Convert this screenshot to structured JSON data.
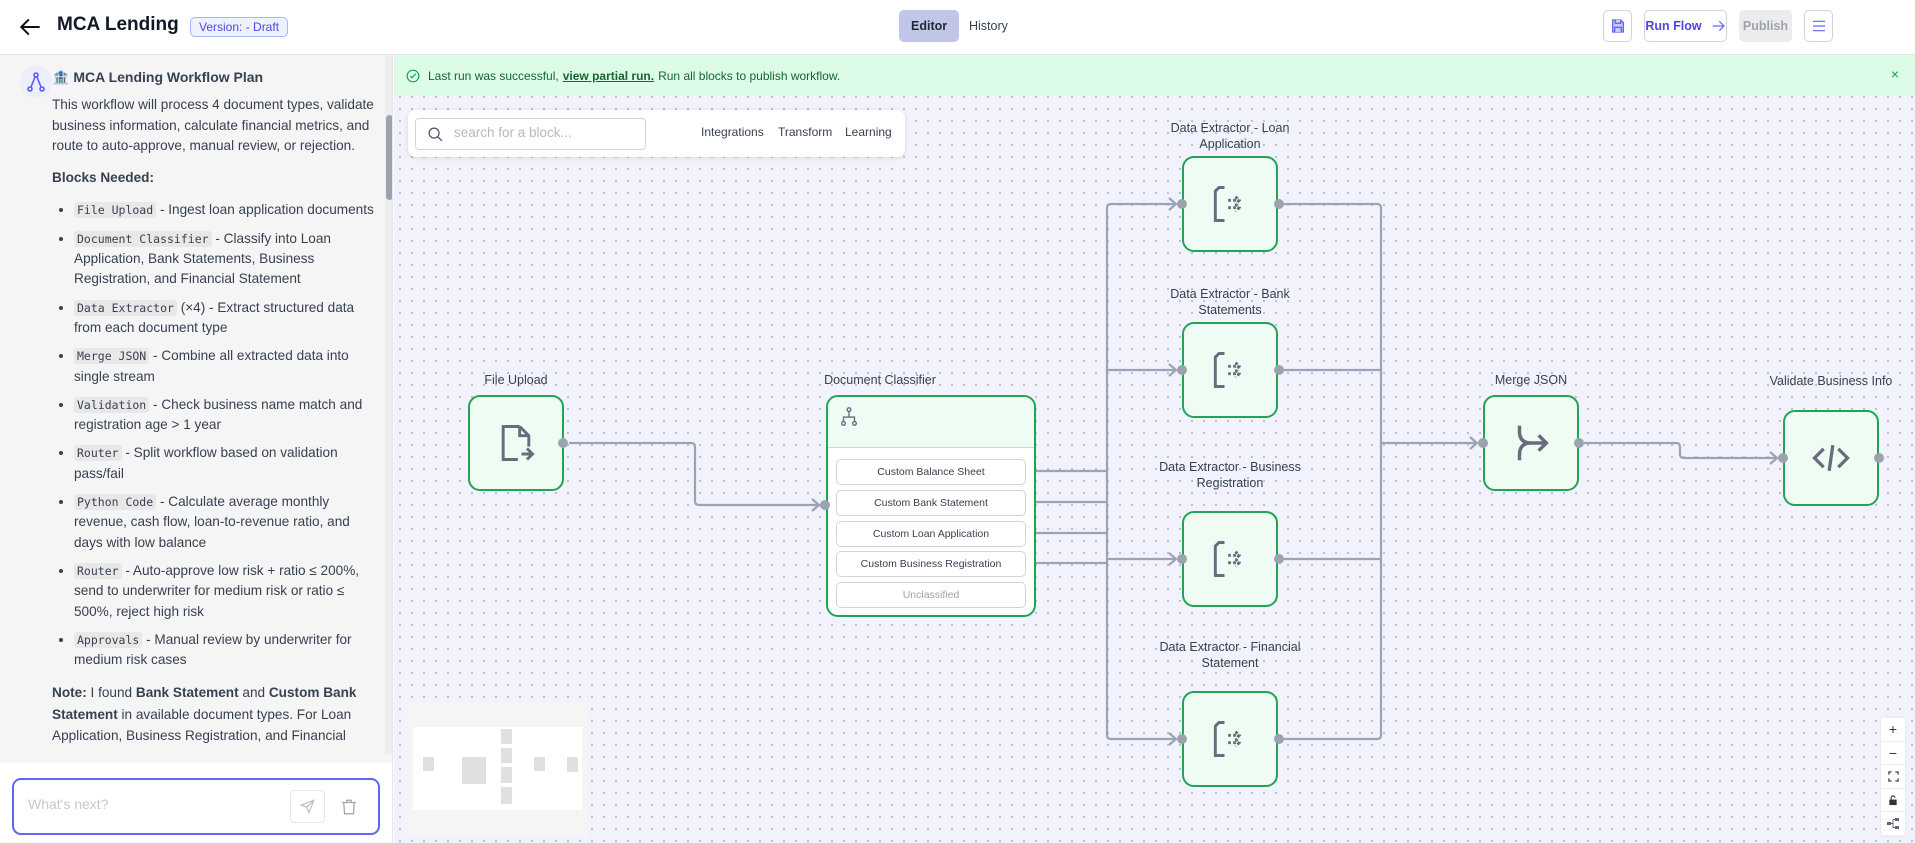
{
  "header": {
    "title": "MCA Lending",
    "version_badge": "Version: - Draft",
    "tabs": [
      {
        "label": "Editor",
        "active": true
      },
      {
        "label": "History",
        "active": false
      }
    ],
    "run_flow_label": "Run Flow",
    "publish_label": "Publish",
    "accent": "#4f46e5"
  },
  "sidebar": {
    "heading": "🏦 MCA Lending Workflow Plan",
    "intro": "This workflow will process 4 document types, validate business information, calculate financial metrics, and route to auto-approve, manual review, or rejection.",
    "blocks_heading": "Blocks Needed:",
    "items": [
      {
        "code": "File Upload",
        "text": " - Ingest loan application documents"
      },
      {
        "code": "Document Classifier",
        "text": " - Classify into Loan Application, Bank Statements, Business Registration, and Financial Statement"
      },
      {
        "code": "Data Extractor",
        "text": " (×4) - Extract structured data from each document type"
      },
      {
        "code": "Merge JSON",
        "text": " - Combine all extracted data into single stream"
      },
      {
        "code": "Validation",
        "text": " - Check business name match and registration age > 1 year"
      },
      {
        "code": "Router",
        "text": " - Split workflow based on validation pass/fail"
      },
      {
        "code": "Python Code",
        "text": " - Calculate average monthly revenue, cash flow, loan-to-revenue ratio, and days with low balance"
      },
      {
        "code": "Router",
        "text": " - Auto-approve low risk + ratio ≤ 200%, send to underwriter for medium risk or ratio ≤ 500%, reject high risk"
      },
      {
        "code": "Approvals",
        "text": " - Manual review by underwriter for medium risk cases"
      }
    ],
    "note": {
      "label": "Note:",
      "t1": " I found ",
      "b1": "Bank Statement",
      "t2": " and ",
      "b2": "Custom Bank Statement",
      "t3": " in available document types. For Loan Application, Business Registration, and Financial"
    },
    "chat_placeholder": "What's next?"
  },
  "banner": {
    "pre": "Last run was successful,",
    "link": "view partial run.",
    "post": "Run all blocks to publish workflow."
  },
  "block_search": {
    "placeholder": "search for a block...",
    "tabs": [
      "Integrations",
      "Transform",
      "Learning"
    ]
  },
  "nodes": {
    "file_upload": "File Upload",
    "classifier": {
      "label": "Document Classifier",
      "options": [
        "Custom Balance Sheet",
        "Custom Bank Statement",
        "Custom Loan Application",
        "Custom Business Registration",
        "Unclassified"
      ]
    },
    "extractors": [
      "Data Extractor - Loan Application",
      "Data Extractor - Bank Statements",
      "Data Extractor - Business Registration",
      "Data Extractor - Financial Statement"
    ],
    "merge": "Merge JSON",
    "validate": "Validate Business Info"
  },
  "zoom_controls": [
    "zoom-in",
    "zoom-out",
    "fit-view",
    "lock",
    "layout"
  ]
}
